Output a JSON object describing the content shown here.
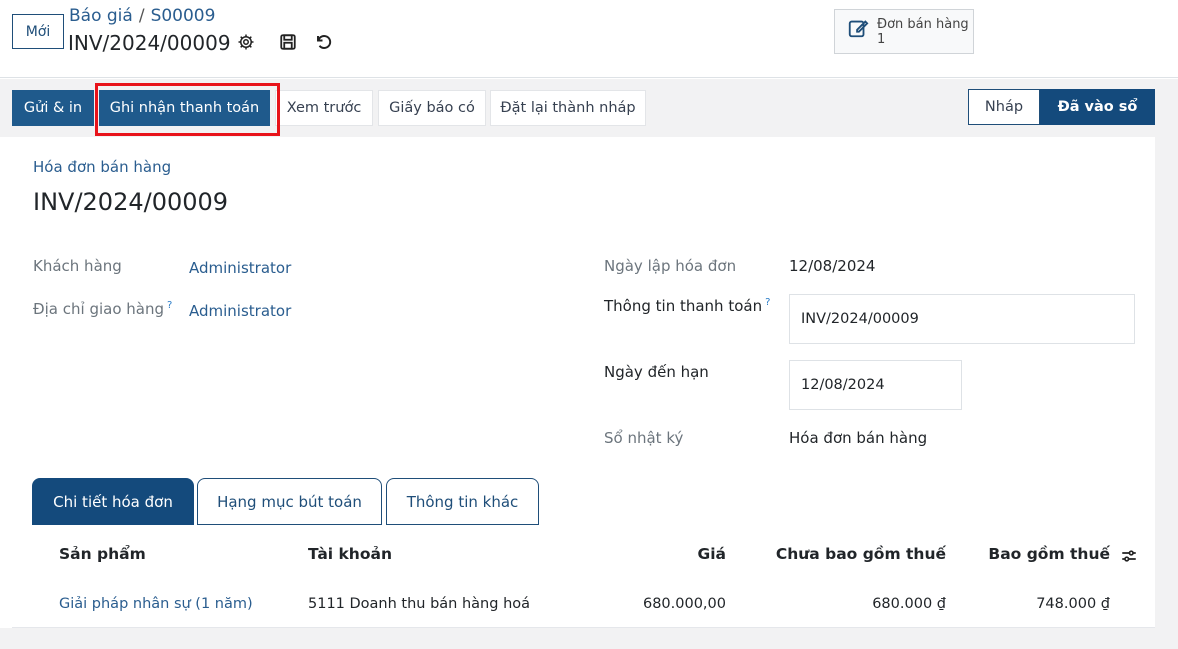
{
  "header": {
    "new_button": "Mới",
    "breadcrumb_parent": "Báo giá",
    "breadcrumb_separator": "/",
    "breadcrumb_current": "S00009",
    "record_title": "INV/2024/00009",
    "icons": [
      "gear-icon",
      "save-icon",
      "undo-icon"
    ],
    "smart_button": {
      "label": "Đơn bán hàng",
      "count": "1",
      "icon": "edit-icon"
    }
  },
  "actions": {
    "send_print": "Gửi & in",
    "register_payment": "Ghi nhận thanh toán",
    "preview": "Xem trước",
    "credit_note": "Giấy báo có",
    "reset_draft": "Đặt lại thành nháp"
  },
  "statusbar": {
    "draft": "Nháp",
    "posted": "Đã vào sổ"
  },
  "form": {
    "doc_type": "Hóa đơn bán hàng",
    "doc_number": "INV/2024/00009",
    "customer_label": "Khách hàng",
    "customer_value": "Administrator",
    "delivery_label": "Địa chỉ giao hàng",
    "delivery_help": "?",
    "delivery_value": "Administrator",
    "invoice_date_label": "Ngày lập hóa đơn",
    "invoice_date_value": "12/08/2024",
    "payment_ref_label": "Thông tin thanh toán",
    "payment_ref_help": "?",
    "payment_ref_value": "INV/2024/00009",
    "due_date_label": "Ngày đến hạn",
    "due_date_value": "12/08/2024",
    "journal_label": "Sổ nhật ký",
    "journal_value": "Hóa đơn bán hàng"
  },
  "tabs": [
    "Chi tiết hóa đơn",
    "Hạng mục bút toán",
    "Thông tin khác"
  ],
  "table": {
    "columns": [
      "Sản phẩm",
      "Tài khoản",
      "Giá",
      "Chưa bao gồm thuế",
      "Bao gồm thuế"
    ],
    "rows": [
      [
        "Giải pháp nhân sự (1 năm)",
        "5111 Doanh thu bán hàng hoá",
        "680.000,00",
        "680.000 ₫",
        "748.000 ₫"
      ]
    ]
  },
  "colors": {
    "primary": "#1f5a8c",
    "highlight": "#e8131a",
    "link": "#2a5d8f"
  }
}
